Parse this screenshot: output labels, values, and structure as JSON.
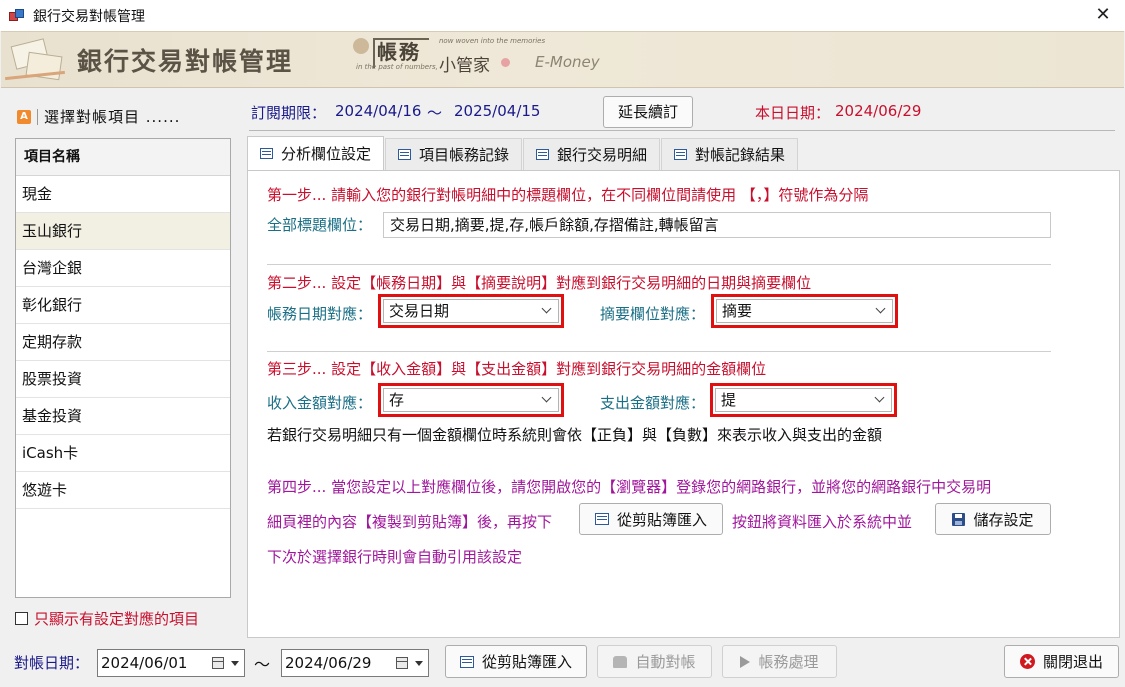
{
  "window": {
    "title": "銀行交易對帳管理",
    "close_glyph": "✕"
  },
  "banner": {
    "title": "銀行交易對帳管理",
    "brand_main": "帳務",
    "brand_sub": "小管家",
    "tagline_top": "now woven into the memories",
    "tagline_bottom": "in the past of numbers,",
    "emoney": "E-Money"
  },
  "left": {
    "header": "選擇對帳項目 ......",
    "header_icon_letter": "A",
    "column_header": "項目名稱",
    "items": [
      "現金",
      "玉山銀行",
      "台灣企銀",
      "彰化銀行",
      "定期存款",
      "股票投資",
      "基金投資",
      "iCash卡",
      "悠遊卡"
    ],
    "selected_index": 1,
    "only_mapped_label": "只顯示有設定對應的項目",
    "only_mapped_checked": false
  },
  "subscription": {
    "label": "訂閱期限：",
    "start": "2024/04/16",
    "tilde": "～",
    "end": "2025/04/15",
    "renew_button": "延長續訂",
    "today_label": "本日日期：",
    "today": "2024/06/29"
  },
  "tabs": [
    {
      "label": "分析欄位設定",
      "active": true
    },
    {
      "label": "項目帳務記錄",
      "active": false
    },
    {
      "label": "銀行交易明細",
      "active": false
    },
    {
      "label": "對帳記錄結果",
      "active": false
    }
  ],
  "step1": {
    "title": "第一步... 請輸入您的銀行對帳明細中的標題欄位，在不同欄位間請使用 【，】符號作為分隔",
    "header_label": "全部標題欄位：",
    "header_value": "交易日期,摘要,提,存,帳戶餘額,存摺備註,轉帳留言"
  },
  "step2": {
    "title": "第二步... 設定【帳務日期】與【摘要說明】對應到銀行交易明細的日期與摘要欄位",
    "date_label": "帳務日期對應：",
    "date_value": "交易日期",
    "summary_label": "摘要欄位對應：",
    "summary_value": "摘要"
  },
  "step3": {
    "title": "第三步... 設定【收入金額】與【支出金額】對應到銀行交易明細的金額欄位",
    "income_label": "收入金額對應：",
    "income_value": "存",
    "expense_label": "支出金額對應：",
    "expense_value": "提",
    "note": "若銀行交易明細只有一個金額欄位時系統則會依【正負】與【負數】來表示收入與支出的金額"
  },
  "step4": {
    "line1": "第四步... 當您設定以上對應欄位後，請您開啟您的【瀏覽器】登錄您的網路銀行，並將您的網路銀行中交易明",
    "line2_pre": "細頁裡的內容【複製到剪貼簿】後，再按下",
    "import_button": "從剪貼簿匯入",
    "line2_post": "按鈕將資料匯入於系統中並",
    "save_button": "儲存設定",
    "line3": "下次於選擇銀行時則會自動引用該設定"
  },
  "bottom": {
    "date_label": "對帳日期：",
    "from": "2024/06/01",
    "tilde": "～",
    "to": "2024/06/29",
    "import_button": "從剪貼簿匯入",
    "auto_button": "自動對帳",
    "process_button": "帳務處理",
    "exit_button": "關閉退出"
  },
  "colors": {
    "red_label": "#c8102e",
    "navy_label": "#1a1a8a",
    "teal_label": "#1a6f86",
    "purple_label": "#a0179c",
    "highlight_box": "#e01010"
  }
}
